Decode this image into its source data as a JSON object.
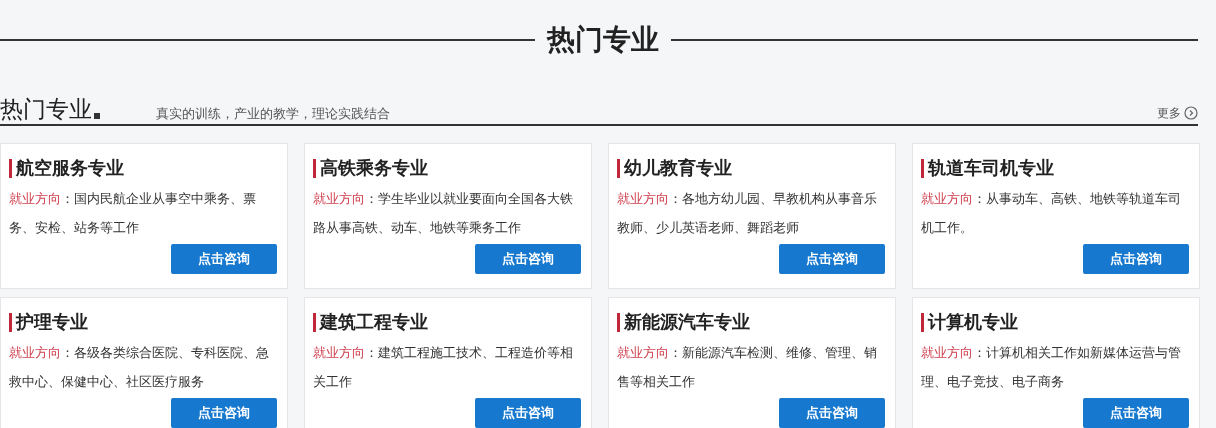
{
  "page_title": "热门专业",
  "section": {
    "title": "热门专业",
    "subtitle": "真实的训练，产业的教学，理论实践结合",
    "more": "更多"
  },
  "cards": [
    {
      "title": "航空服务专业",
      "label": "就业方向",
      "separator": "：",
      "text": "国内民航企业从事空中乘务、票务、安检、站务等工作",
      "button": "点击咨询"
    },
    {
      "title": "高铁乘务专业",
      "label": "就业方向",
      "separator": "：",
      "text": "学生毕业以就业要面向全国各大铁路从事高铁、动车、地铁等乘务工作",
      "button": "点击咨询"
    },
    {
      "title": "幼儿教育专业",
      "label": "就业方向",
      "separator": "：",
      "text": "各地方幼儿园、早教机构从事音乐教师、少儿英语老师、舞蹈老师",
      "button": "点击咨询"
    },
    {
      "title": "轨道车司机专业",
      "label": "就业方向",
      "separator": "：",
      "text": "从事动车、高铁、地铁等轨道车司机工作。",
      "button": "点击咨询"
    },
    {
      "title": "护理专业",
      "label": "就业方向",
      "separator": "：",
      "text": "各级各类综合医院、专科医院、急救中心、保健中心、社区医疗服务",
      "button": "点击咨询"
    },
    {
      "title": "建筑工程专业",
      "label": "就业方向",
      "separator": "：",
      "text": "建筑工程施工技术、工程造价等相关工作",
      "button": "点击咨询"
    },
    {
      "title": "新能源汽车专业",
      "label": "就业方向",
      "separator": "：",
      "text": "新能源汽车检测、维修、管理、销售等相关工作",
      "button": "点击咨询"
    },
    {
      "title": "计算机专业",
      "label": "就业方向",
      "separator": "：",
      "text": "计算机相关工作如新媒体运营与管理、电子竞技、电子商务",
      "button": "点击咨询"
    }
  ]
}
